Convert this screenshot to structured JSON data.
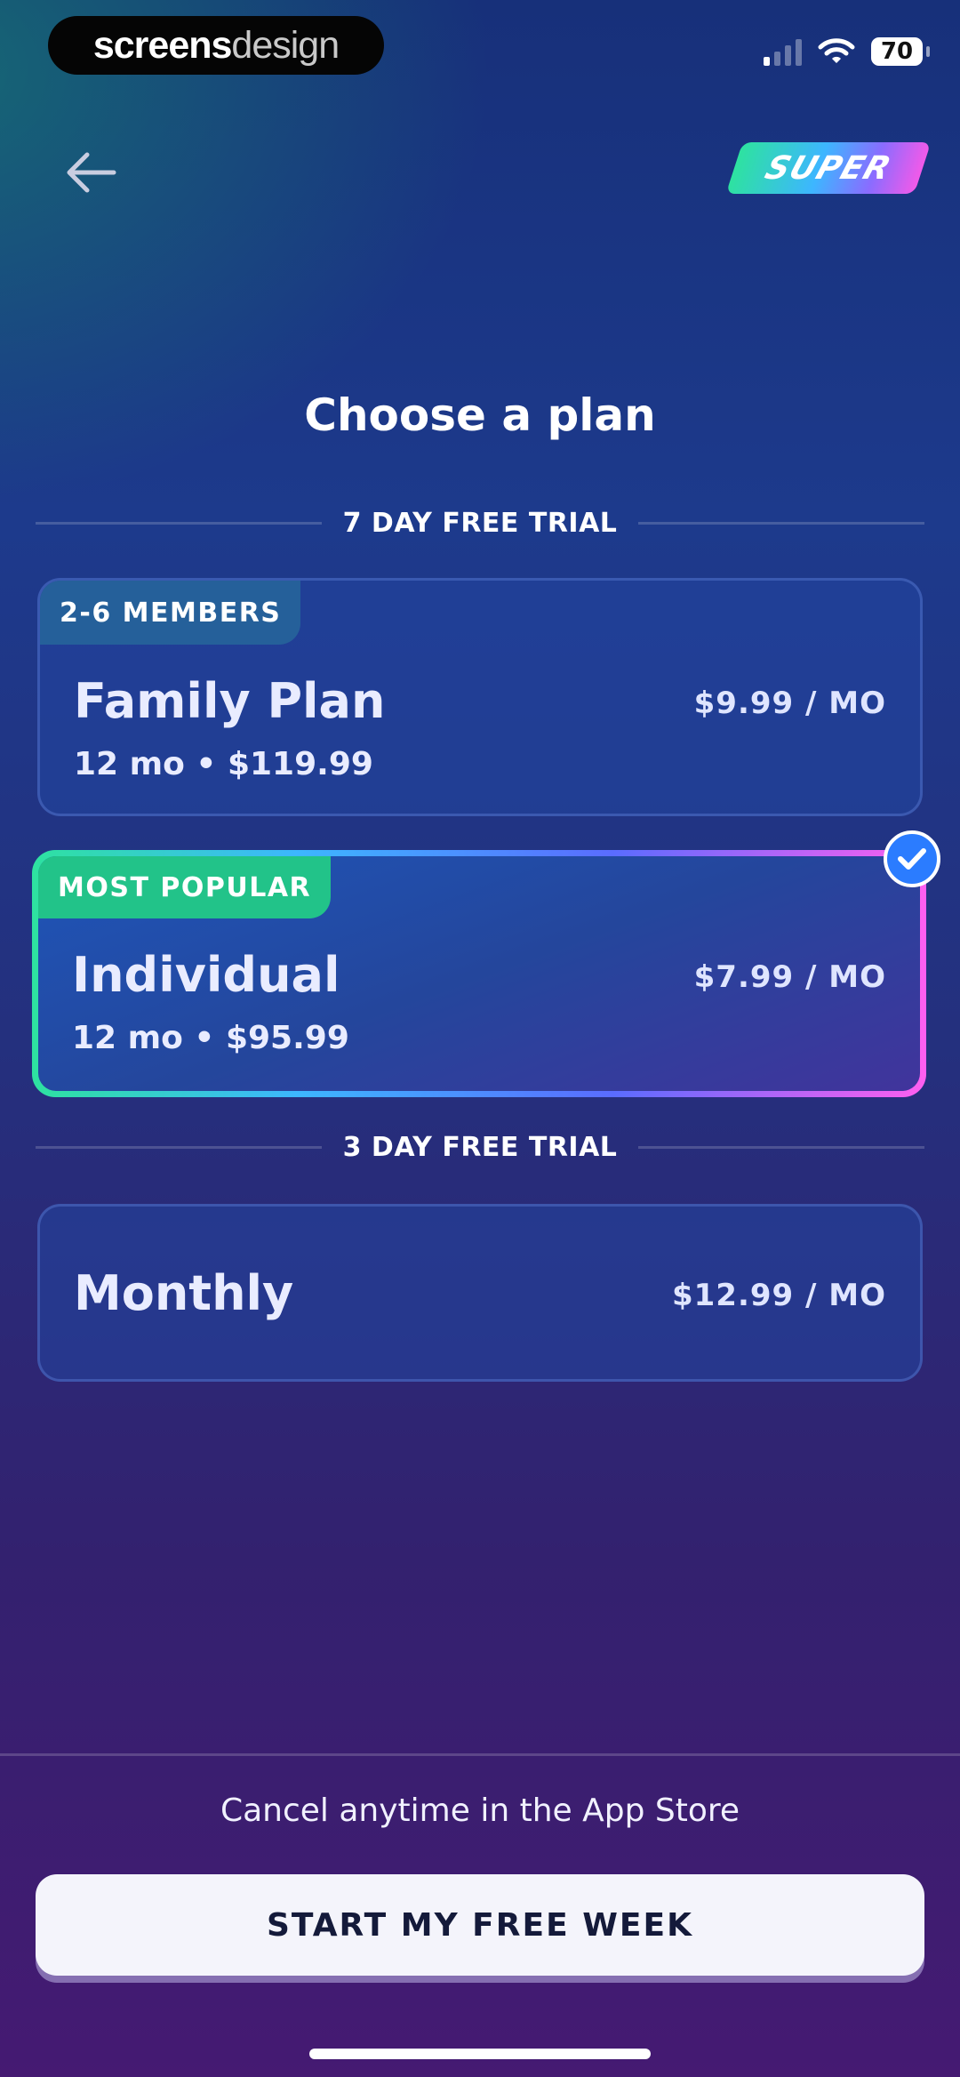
{
  "brand_pill": {
    "part1": "screens",
    "part2": "design"
  },
  "status": {
    "battery": "70"
  },
  "header": {
    "badge": "SUPER"
  },
  "title": "Choose a plan",
  "sections": [
    {
      "label": "7 DAY FREE TRIAL"
    },
    {
      "label": "3 DAY FREE TRIAL"
    }
  ],
  "plans": [
    {
      "tag": "2-6 MEMBERS",
      "name": "Family Plan",
      "detail": "12 mo • $119.99",
      "price": "$9.99 / MO",
      "selected": false
    },
    {
      "tag": "MOST POPULAR",
      "name": "Individual",
      "detail": "12 mo • $95.99",
      "price": "$7.99 / MO",
      "selected": true
    },
    {
      "name": "Monthly",
      "price": "$12.99 / MO",
      "selected": false
    }
  ],
  "footer": {
    "note": "Cancel anytime in the App Store",
    "cta": "START MY FREE WEEK"
  },
  "colors": {
    "tag_blue": "#25609a",
    "tag_green": "#22c389",
    "check_blue": "#2b7cff"
  },
  "icons": [
    "back-arrow-icon",
    "signal-icon",
    "wifi-icon",
    "battery-icon",
    "checkmark-icon"
  ]
}
